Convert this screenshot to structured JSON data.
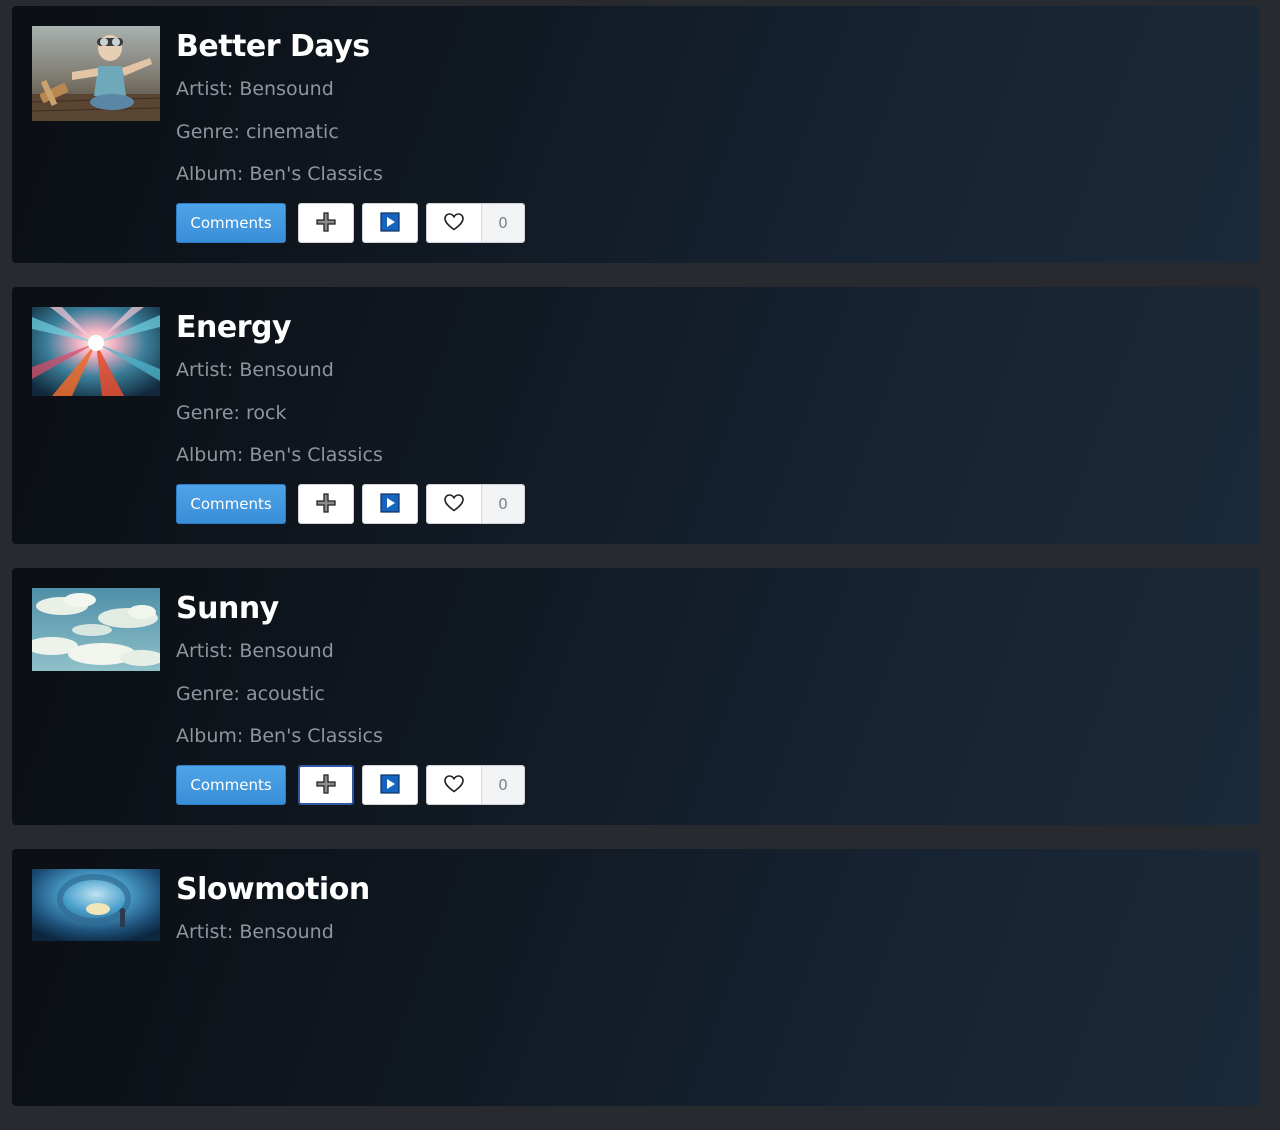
{
  "songs": [
    {
      "title": "Better Days",
      "artist": "Artist: Bensound",
      "genre": "Genre: cinematic",
      "album": "Album: Ben's Classics",
      "comments_label": "Comments",
      "likes": "0",
      "thumbnail_icon": "boy-with-toy-plane-image"
    },
    {
      "title": "Energy",
      "artist": "Artist: Bensound",
      "genre": "Genre: rock",
      "album": "Album: Ben's Classics",
      "comments_label": "Comments",
      "likes": "0",
      "thumbnail_icon": "light-burst-image"
    },
    {
      "title": "Sunny",
      "artist": "Artist: Bensound",
      "genre": "Genre: acoustic",
      "album": "Album: Ben's Classics",
      "comments_label": "Comments",
      "likes": "0",
      "thumbnail_icon": "cloudy-sky-image"
    },
    {
      "title": "Slowmotion",
      "artist": "Artist: Bensound",
      "genre": "",
      "album": "",
      "comments_label": "",
      "likes": "",
      "thumbnail_icon": "person-in-cave-image"
    }
  ],
  "icons": {
    "add": "plus-icon",
    "play": "play-icon",
    "like": "heart-icon"
  },
  "colors": {
    "page_background": "#272a2e",
    "card_gradient_start": "#0b0f14",
    "card_gradient_end": "#1b2a3a",
    "comments_button": "#3a8ed6",
    "play_icon": "#1565c0",
    "focus_outline": "#2f55a3",
    "meta_text": "#8f959c"
  }
}
